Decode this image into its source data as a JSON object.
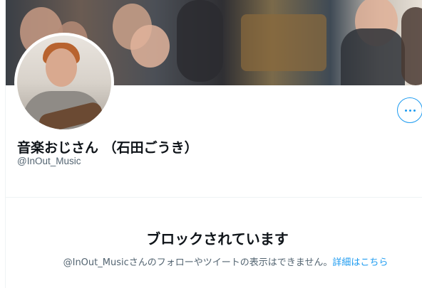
{
  "profile": {
    "display_name": "音楽おじさん （石田ごうき）",
    "handle": "@InOut_Music",
    "more_icon": "more-horizontal-icon"
  },
  "blocked": {
    "title": "ブロックされています",
    "description": "@InOut_Musicさんのフォローやツイートの表示はできません。",
    "details_link": "詳細はこちら"
  },
  "colors": {
    "accent": "#1d9bf0",
    "text_primary": "#0f1419",
    "text_secondary": "#536471",
    "border": "#eff3f4"
  }
}
